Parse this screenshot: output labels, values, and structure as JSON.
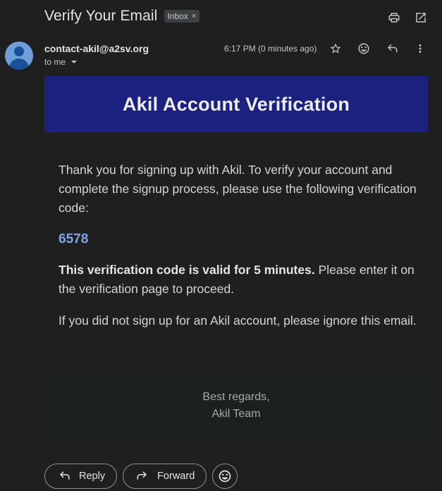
{
  "subject": "Verify Your Email",
  "label_chip": {
    "text": "Inbox",
    "remove": "×"
  },
  "toolbar": {
    "print_icon": "print-icon",
    "popout_icon": "open-in-new-icon"
  },
  "message": {
    "sender": "contact-akil@a2sv.org",
    "recipient": "to me",
    "timestamp": "6:17 PM (0 minutes ago)",
    "actions": [
      "star-icon",
      "emoji-icon",
      "reply-icon",
      "more-vert-icon"
    ]
  },
  "email": {
    "banner_title": "Akil Account Verification",
    "intro": "Thank you for signing up with Akil. To verify your account and complete the signup process, please use the following verification code:",
    "code": "6578",
    "validity_bold": "This verification code is valid for 5 minutes.",
    "validity_rest": " Please enter it on the verification page to proceed.",
    "ignore": "If you did not sign up for an Akil account, please ignore this email.",
    "signoff": "Best regards,",
    "team": "Akil Team"
  },
  "bottom": {
    "reply": "Reply",
    "forward": "Forward"
  },
  "colors": {
    "background": "#1f1f1f",
    "banner": "#1c2180",
    "code": "#7ea4e6",
    "avatar": "#6f9fd9"
  }
}
